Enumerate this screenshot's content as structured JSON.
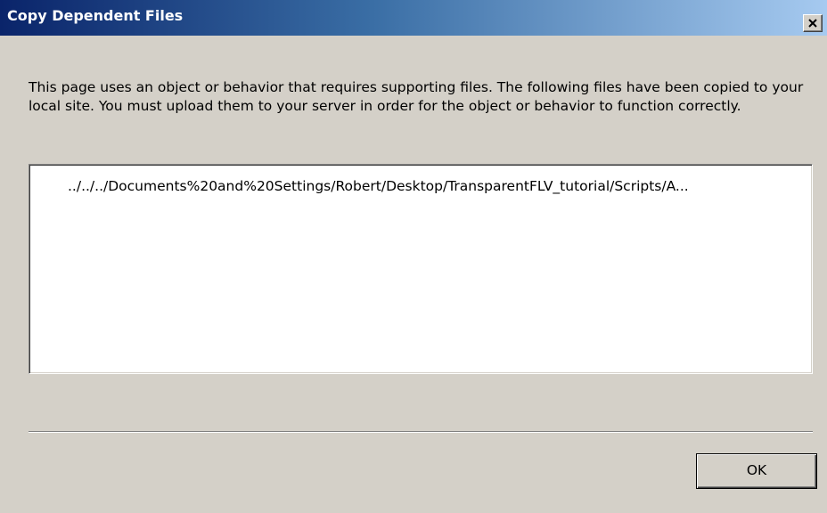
{
  "window": {
    "title": "Copy Dependent Files"
  },
  "message": {
    "text": "This page uses an object or behavior that requires supporting files. The following files have been copied to your local site. You must upload them to your server in order for the object or behavior to function correctly."
  },
  "files": {
    "items": [
      "../../../Documents%20and%20Settings/Robert/Desktop/TransparentFLV_tutorial/Scripts/A..."
    ]
  },
  "buttons": {
    "ok_label": "OK"
  },
  "icons": {
    "close": "close-icon"
  },
  "colors": {
    "titlebar_start": "#0a246a",
    "titlebar_end": "#a6caf0",
    "dialog_bg": "#d4d0c8"
  }
}
